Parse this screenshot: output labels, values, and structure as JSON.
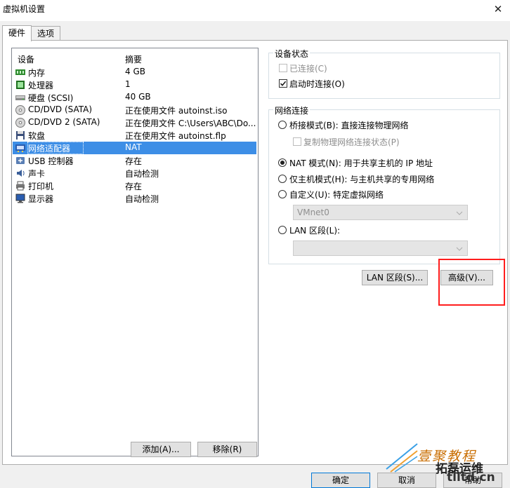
{
  "window": {
    "title": "虚拟机设置",
    "close_glyph": "✕"
  },
  "tabs": [
    {
      "label": "硬件"
    },
    {
      "label": "选项"
    }
  ],
  "device_list": {
    "col_device": "设备",
    "col_summary": "摘要",
    "rows": [
      {
        "name": "内存",
        "summary": "4 GB",
        "icon": "memory-icon"
      },
      {
        "name": "处理器",
        "summary": "1",
        "icon": "processor-icon"
      },
      {
        "name": "硬盘 (SCSI)",
        "summary": "40 GB",
        "icon": "hard-disk-icon"
      },
      {
        "name": "CD/DVD (SATA)",
        "summary": "正在使用文件 autoinst.iso",
        "icon": "cd-dvd-icon"
      },
      {
        "name": "CD/DVD 2 (SATA)",
        "summary": "正在使用文件 C:\\Users\\ABC\\Do...",
        "icon": "cd-dvd-icon"
      },
      {
        "name": "软盘",
        "summary": "正在使用文件 autoinst.flp",
        "icon": "floppy-icon"
      },
      {
        "name": "网络适配器",
        "summary": "NAT",
        "icon": "network-adapter-icon",
        "selected": true
      },
      {
        "name": "USB 控制器",
        "summary": "存在",
        "icon": "usb-icon"
      },
      {
        "name": "声卡",
        "summary": "自动检测",
        "icon": "sound-card-icon"
      },
      {
        "name": "打印机",
        "summary": "存在",
        "icon": "printer-icon"
      },
      {
        "name": "显示器",
        "summary": "自动检测",
        "icon": "monitor-icon"
      }
    ],
    "add_button": "添加(A)...",
    "remove_button": "移除(R)"
  },
  "device_status": {
    "title": "设备状态",
    "connected": {
      "label": "已连接(C)",
      "checked": false,
      "disabled": true
    },
    "connect_at_power_on": {
      "label": "启动时连接(O)",
      "checked": true
    }
  },
  "network": {
    "title": "网络连接",
    "bridged": {
      "label": "桥接模式(B): 直接连接物理网络",
      "selected": false
    },
    "replicate": {
      "label": "复制物理网络连接状态(P)",
      "checked": false,
      "disabled": true
    },
    "nat": {
      "label": "NAT 模式(N): 用于共享主机的 IP 地址",
      "selected": true
    },
    "host_only": {
      "label": "仅主机模式(H): 与主机共享的专用网络",
      "selected": false
    },
    "custom": {
      "label": "自定义(U): 特定虚拟网络",
      "selected": false
    },
    "vmnet_value": "VMnet0",
    "lan_segment": {
      "label": "LAN 区段(L):",
      "selected": false
    },
    "lan_segment_value": "",
    "lan_segments_button": "LAN 区段(S)...",
    "advanced_button": "高级(V)..."
  },
  "footer": {
    "ok": "确定",
    "cancel": "取消",
    "help": "帮助"
  },
  "watermark": {
    "chinese": "壹聚教程",
    "url": "tlltd.cn",
    "cn2": "拓磊运维"
  },
  "colors": {
    "selection": "#3d8ee6",
    "highlight_rect": "#ff1d1d"
  }
}
